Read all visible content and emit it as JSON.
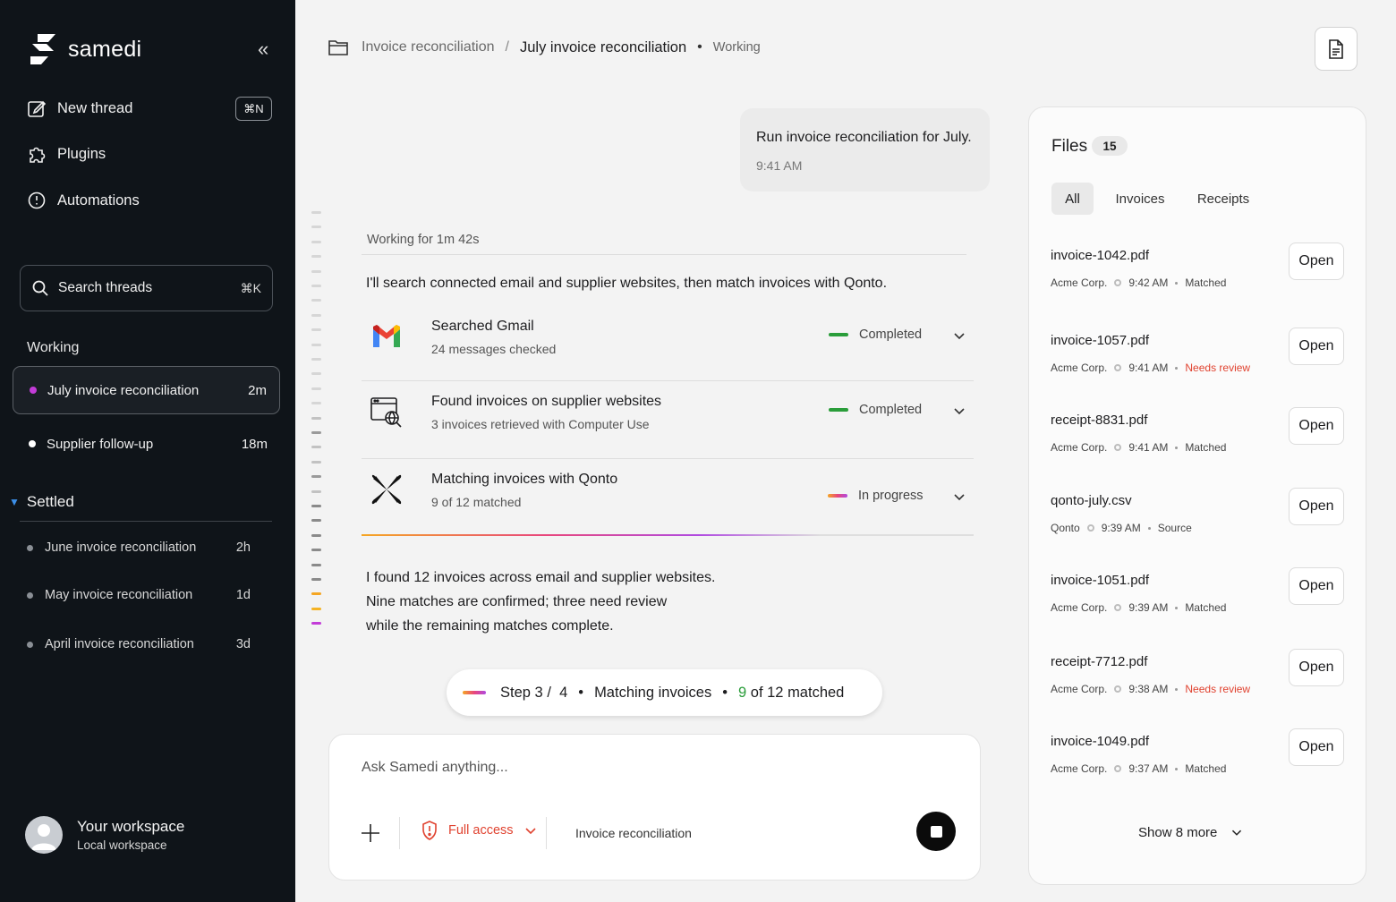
{
  "app": {
    "name": "samedi",
    "collapse_icon": "«"
  },
  "sidebar": {
    "nav": [
      {
        "label": "New thread",
        "icon": "compose-icon",
        "shortcut": "⌘N"
      },
      {
        "label": "Plugins",
        "icon": "puzzle-icon"
      },
      {
        "label": "Automations",
        "icon": "clock-icon"
      }
    ],
    "search": {
      "label": "Search threads",
      "shortcut": "⌘K"
    },
    "working": {
      "label": "Working",
      "threads": [
        {
          "label": "July invoice reconciliation",
          "time": "2m",
          "dot_color": "#c33cd8"
        },
        {
          "label": "Supplier follow-up",
          "time": "18m",
          "dot_color": "#ffffff"
        }
      ]
    },
    "settled": {
      "label": "Settled",
      "threads": [
        {
          "label": "June invoice reconciliation",
          "time": "2h"
        },
        {
          "label": "May invoice reconciliation",
          "time": "1d"
        },
        {
          "label": "April invoice reconciliation",
          "time": "3d"
        }
      ]
    },
    "workspace": {
      "name": "Your workspace",
      "sub": "Local workspace"
    }
  },
  "header": {
    "breadcrumb_parent": "Invoice reconciliation",
    "breadcrumb_sep": "/",
    "breadcrumb_current": "July invoice reconciliation",
    "status": "Working"
  },
  "chat": {
    "user_message": "Run invoice reconciliation for July.",
    "user_time": "9:41 AM",
    "working_for": "Working for 1m 42s",
    "intro": "I'll search connected email and supplier websites, then match invoices with Qonto.",
    "tasks": [
      {
        "title": "Searched Gmail",
        "sub": "24 messages checked",
        "status": "Completed",
        "icon": "gmail-icon"
      },
      {
        "title": "Found invoices on supplier websites",
        "sub": "3 invoices retrieved with Computer Use",
        "status": "Completed",
        "icon": "web-search-icon"
      },
      {
        "title": "Matching invoices with Qonto",
        "sub": "9 of 12 matched",
        "status": "In progress",
        "icon": "qonto-icon"
      }
    ],
    "summary": [
      "I found 12 invoices across email and supplier websites.",
      "Nine matches are confirmed; three need review",
      "while the remaining matches complete."
    ],
    "step": {
      "label": "Step",
      "current": "3",
      "sep": "/",
      "total": "4",
      "name": "Matching invoices",
      "matched": "9",
      "matched_rest": "of 12 matched"
    }
  },
  "composer": {
    "placeholder": "Ask Samedi anything...",
    "access_label": "Full access",
    "context_label": "Invoice reconciliation"
  },
  "files": {
    "title": "Files",
    "count": "15",
    "tabs": [
      "All",
      "Invoices",
      "Receipts"
    ],
    "active_tab": "All",
    "items": [
      {
        "name": "invoice-1042.pdf",
        "source": "Acme Corp.",
        "time": "9:42 AM",
        "status": "Matched",
        "review": false
      },
      {
        "name": "invoice-1057.pdf",
        "source": "Acme Corp.",
        "time": "9:41 AM",
        "status": "Needs review",
        "review": true
      },
      {
        "name": "receipt-8831.pdf",
        "source": "Acme Corp.",
        "time": "9:41 AM",
        "status": "Matched",
        "review": false
      },
      {
        "name": "qonto-july.csv",
        "source": "Qonto",
        "time": "9:39 AM",
        "status": "Source",
        "review": false
      },
      {
        "name": "invoice-1051.pdf",
        "source": "Acme Corp.",
        "time": "9:39 AM",
        "status": "Matched",
        "review": false
      },
      {
        "name": "receipt-7712.pdf",
        "source": "Acme Corp.",
        "time": "9:38 AM",
        "status": "Needs review",
        "review": true
      },
      {
        "name": "invoice-1049.pdf",
        "source": "Acme Corp.",
        "time": "9:37 AM",
        "status": "Matched",
        "review": false
      }
    ],
    "open_label": "Open",
    "show_more": "Show 8 more"
  },
  "colors": {
    "sidebar_bg": "#0f1419",
    "completed": "#2a9d3a",
    "review": "#e0422f",
    "active_dot": "#c33cd8",
    "progress_gradient": [
      "#f5a623",
      "#e8467c",
      "#b04ae0"
    ]
  }
}
